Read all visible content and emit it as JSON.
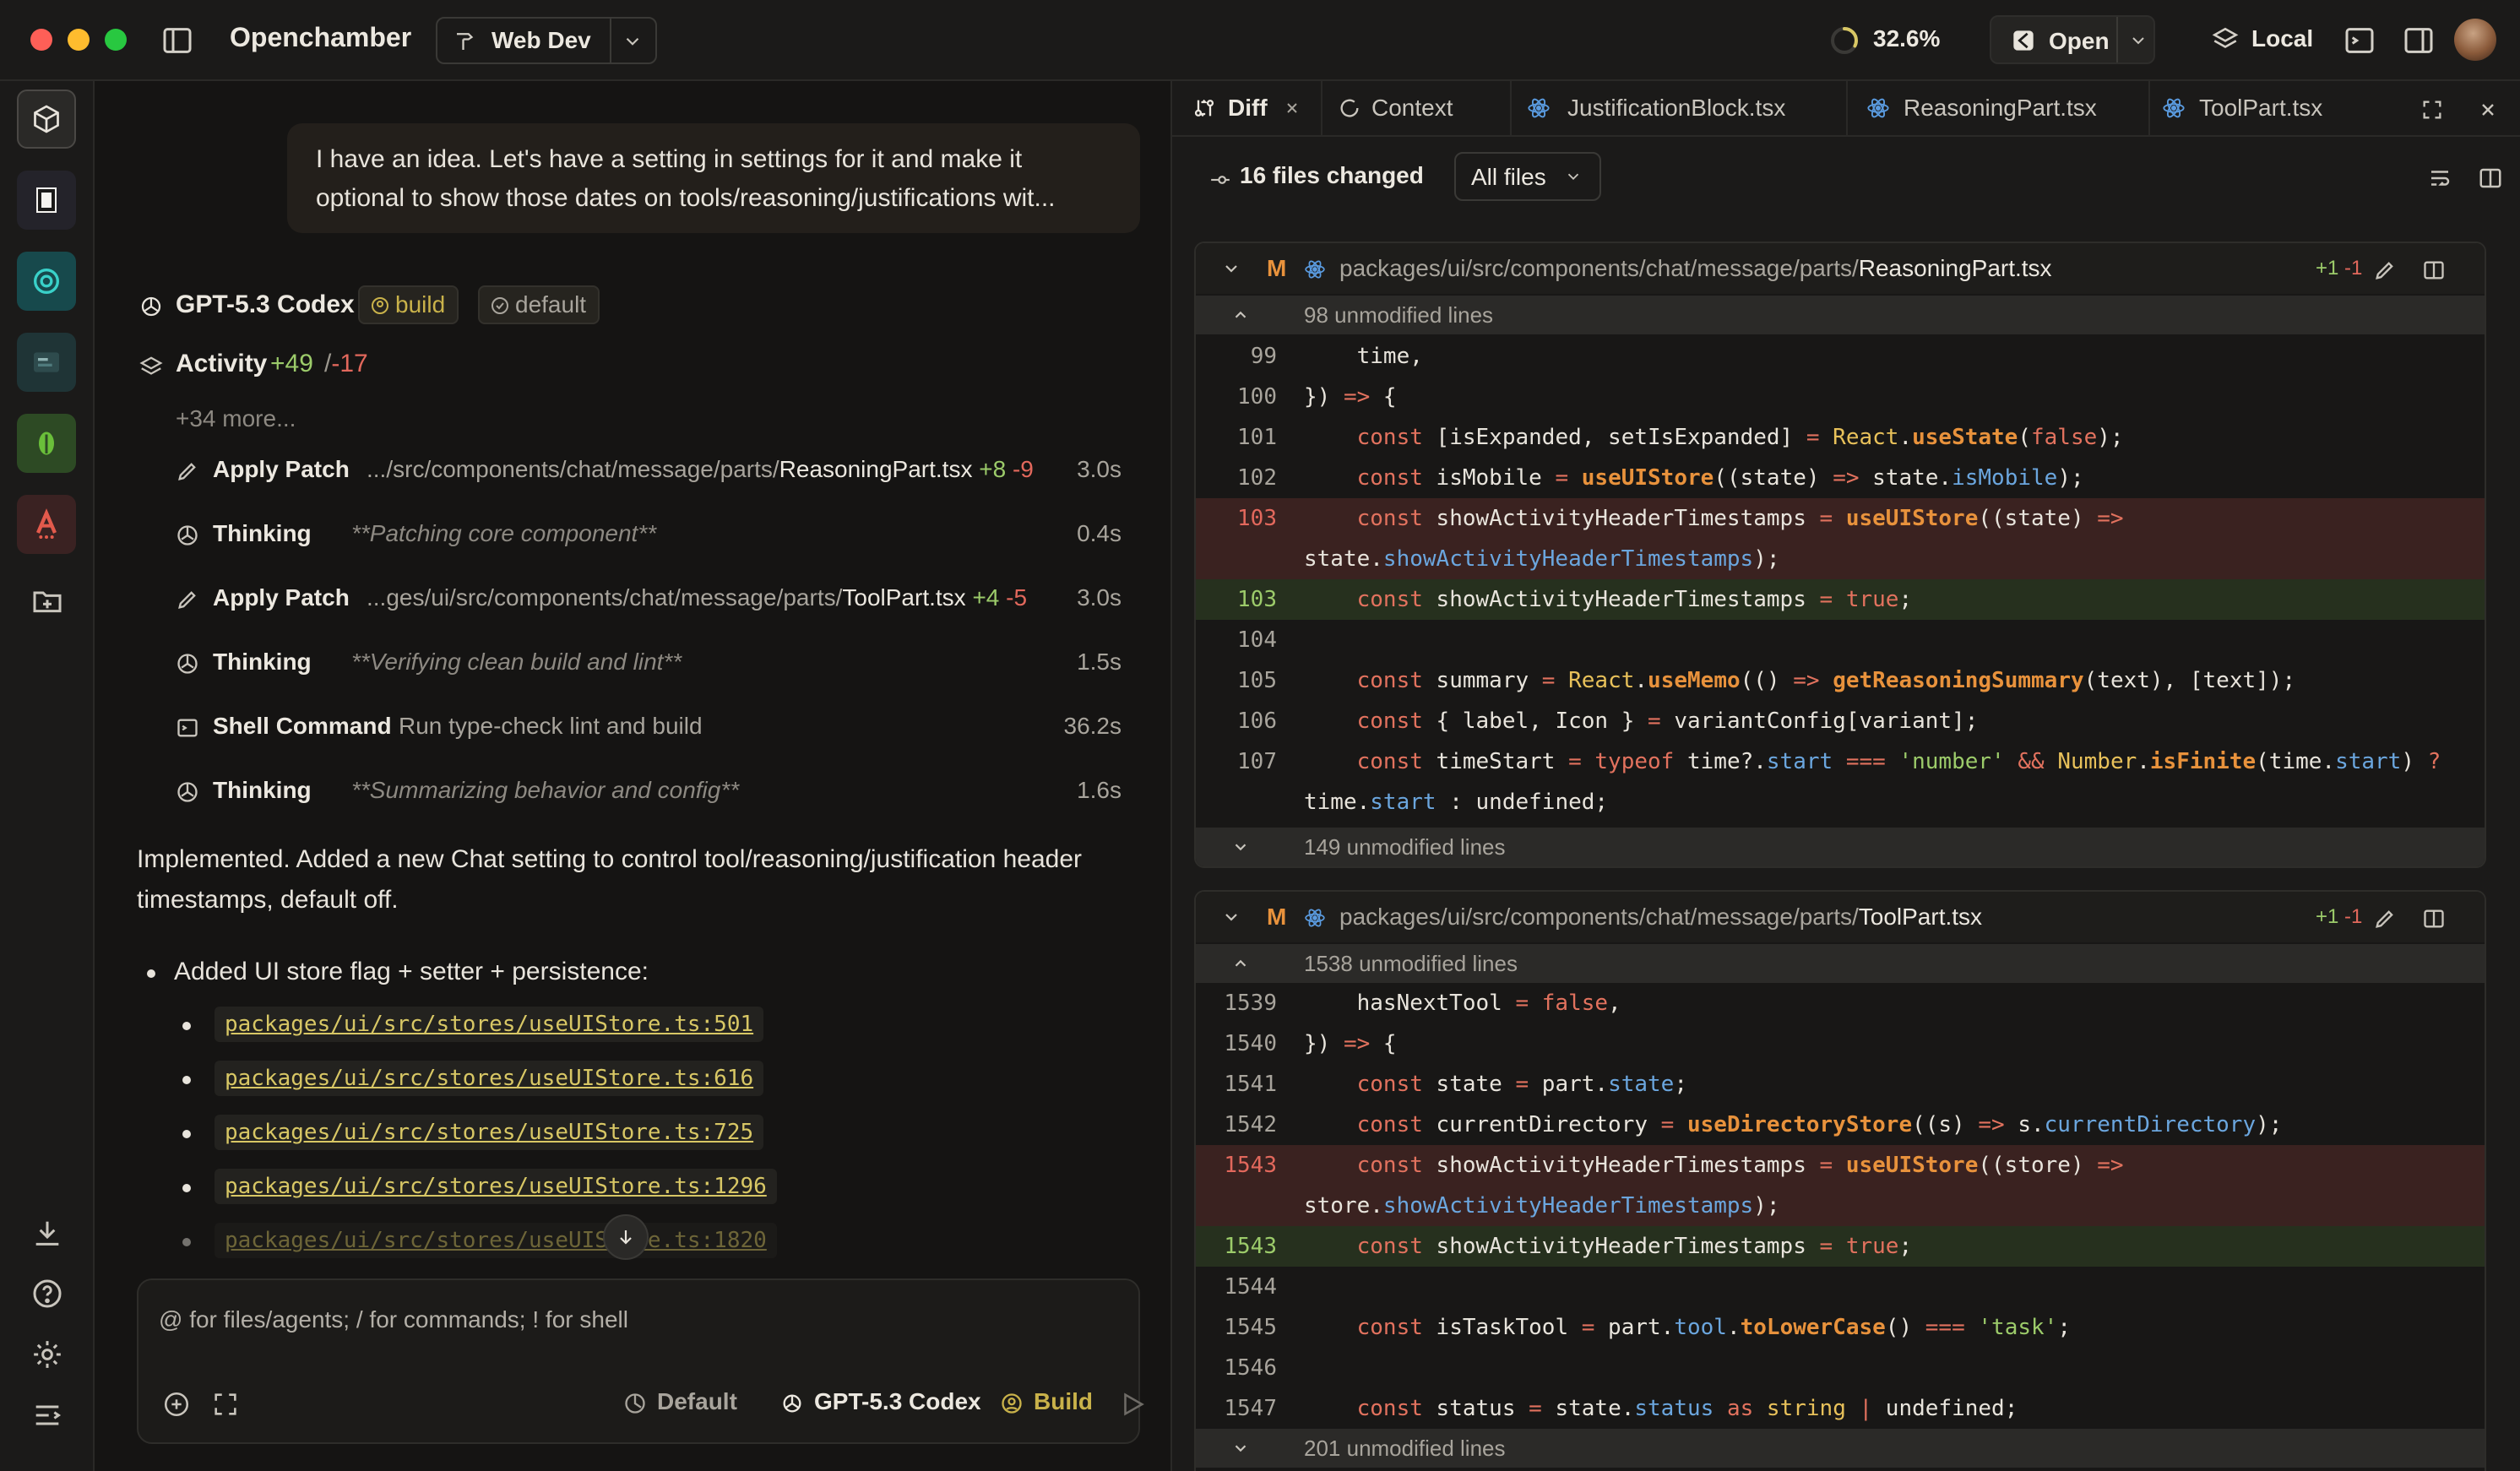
{
  "window": {
    "app_name": "Openchamber",
    "project": "Web Dev",
    "progress": "32.6%",
    "progress_value": 0.326,
    "open_label": "Open",
    "local_label": "Local"
  },
  "rail": {
    "items": [
      "box-icon",
      "square-icon",
      "chat-logo-icon",
      "terminal-logo-icon",
      "leaf-logo-icon",
      "a-logo-icon",
      "new-folder-icon"
    ],
    "bottom": [
      "download-icon",
      "help-icon",
      "settings-icon",
      "menu-icon"
    ]
  },
  "chat": {
    "user_message": "I have an idea. Let's have a setting in settings for it and make it optional to show those dates on tools/reasoning/justifications wit...",
    "model": "GPT-5.3 Codex",
    "chip_build": "build",
    "chip_default": "default",
    "activity": {
      "label": "Activity",
      "added": "+49",
      "sep": "/",
      "removed": "-17",
      "more": "+34 more..."
    },
    "activities": [
      {
        "title": "Apply Patch",
        "path_prefix": ".../src/components/chat/message/parts/",
        "path_file": "ReasoningPart.tsx",
        "added": "+8",
        "removed": "-9",
        "duration": "3.0s"
      },
      {
        "title": "Thinking",
        "note": "**Patching core component**",
        "duration": "0.4s"
      },
      {
        "title": "Apply Patch",
        "path_prefix": "...ges/ui/src/components/chat/message/parts/",
        "path_file": "ToolPart.tsx",
        "added": "+4",
        "removed": "-5",
        "duration": "3.0s"
      },
      {
        "title": "Thinking",
        "note": "**Verifying clean build and lint**",
        "duration": "1.5s"
      },
      {
        "title": "Shell Command",
        "note": "Run type-check lint and build",
        "duration": "36.2s"
      },
      {
        "title": "Thinking",
        "note": "**Summarizing behavior and config**",
        "duration": "1.6s"
      }
    ],
    "implemented": "Implemented. Added a new Chat setting to control tool/reasoning/justification header timestamps, default off.",
    "bullet": "Added UI store flag + setter + persistence:",
    "links": [
      "packages/ui/src/stores/useUIStore.ts:501",
      "packages/ui/src/stores/useUIStore.ts:616",
      "packages/ui/src/stores/useUIStore.ts:725",
      "packages/ui/src/stores/useUIStore.ts:1296",
      "packages/ui/src/stores/useUIStore.ts:1820"
    ],
    "composer": {
      "placeholder": "@ for files/agents; / for commands; ! for shell",
      "opt_default": "Default",
      "opt_model": "GPT-5.3 Codex",
      "opt_build": "Build"
    }
  },
  "diff": {
    "tabs": [
      "Diff",
      "Context",
      "JustificationBlock.tsx",
      "ReasoningPart.tsx",
      "ToolPart.tsx"
    ],
    "files_changed": "16 files changed",
    "files_filter": "All files",
    "files": [
      {
        "badge": "M",
        "path_prefix": "packages/ui/src/components/chat/message/parts/",
        "path_file": "ReasoningPart.tsx",
        "added": "+1",
        "removed": "-1",
        "fold_top": "98 unmodified lines",
        "fold_bottom": "149 unmodified lines"
      },
      {
        "badge": "M",
        "path_prefix": "packages/ui/src/components/chat/message/parts/",
        "path_file": "ToolPart.tsx",
        "added": "+1",
        "removed": "-1",
        "fold_top": "1538 unmodified lines",
        "fold_bottom": "201 unmodified lines"
      }
    ]
  }
}
